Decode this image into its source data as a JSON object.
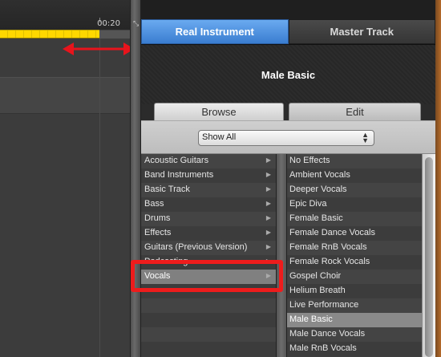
{
  "timeline": {
    "time_marker": "00:20"
  },
  "tabs": [
    {
      "label": "Real Instrument",
      "active": true
    },
    {
      "label": "Master Track",
      "active": false
    }
  ],
  "preview": {
    "title": "Male Basic"
  },
  "subtabs": [
    {
      "label": "Browse",
      "active": true
    },
    {
      "label": "Edit",
      "active": false
    }
  ],
  "filter": {
    "selected": "Show All"
  },
  "categories": [
    {
      "label": "Acoustic Guitars",
      "has_submenu": true
    },
    {
      "label": "Band Instruments",
      "has_submenu": true
    },
    {
      "label": "Basic Track",
      "has_submenu": true
    },
    {
      "label": "Bass",
      "has_submenu": true
    },
    {
      "label": "Drums",
      "has_submenu": true
    },
    {
      "label": "Effects",
      "has_submenu": true
    },
    {
      "label": "Guitars (Previous Version)",
      "has_submenu": true
    },
    {
      "label": "Podcasting",
      "has_submenu": true
    },
    {
      "label": "Vocals",
      "has_submenu": true,
      "selected": true
    }
  ],
  "presets": [
    {
      "label": "No Effects"
    },
    {
      "label": "Ambient Vocals"
    },
    {
      "label": "Deeper Vocals"
    },
    {
      "label": "Epic Diva"
    },
    {
      "label": "Female Basic"
    },
    {
      "label": "Female Dance Vocals"
    },
    {
      "label": "Female RnB Vocals"
    },
    {
      "label": "Female Rock Vocals"
    },
    {
      "label": "Gospel Choir"
    },
    {
      "label": "Helium Breath"
    },
    {
      "label": "Live Performance"
    },
    {
      "label": "Male Basic",
      "selected": true
    },
    {
      "label": "Male Dance Vocals"
    },
    {
      "label": "Male RnB Vocals"
    }
  ],
  "colors": {
    "accent_tab": "#3a7dd0",
    "cycle_region": "#ffd800",
    "annotation_arrow": "#e8141c",
    "annotation_box": "#ee1c1c"
  },
  "icons": {
    "resize_arrow": "double-headed-arrow-icon",
    "submenu": "triangle-right-icon",
    "popup": "up-down-chevrons-icon"
  }
}
